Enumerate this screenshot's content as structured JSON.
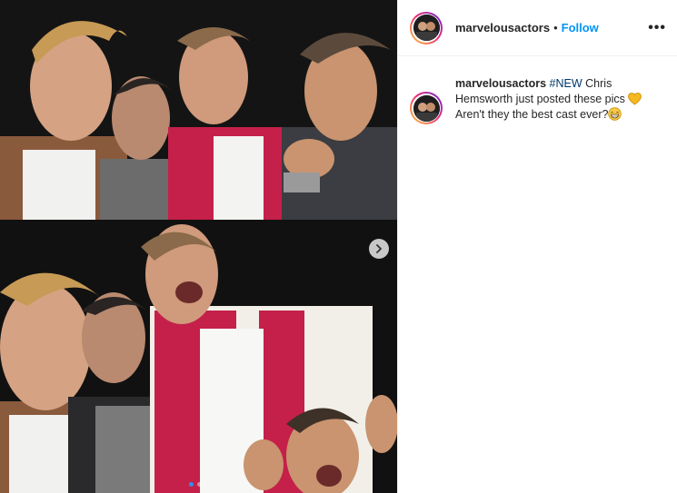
{
  "post": {
    "username": "marvelousactors",
    "separator": "•",
    "follow_label": "Follow",
    "more_label": "•••",
    "caption": {
      "username": "marvelousactors",
      "hashtag": "#NEW",
      "line1": " Chris Hemsworth just posted these pics ",
      "line2": " Aren't they the best cast ever?"
    },
    "carousel": {
      "current": 1,
      "total": 2,
      "next_icon": "chevron-right-icon"
    }
  },
  "colors": {
    "follow": "#0095f6",
    "hashtag": "#00376b",
    "active_dot": "#2f8ff0"
  }
}
